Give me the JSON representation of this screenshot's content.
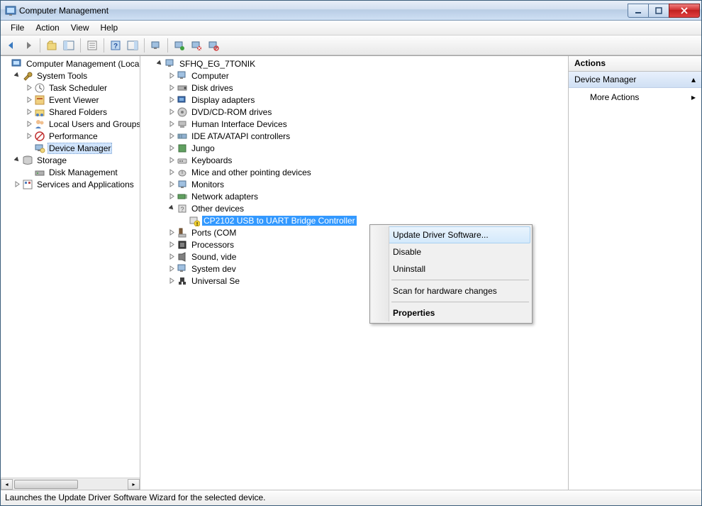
{
  "window": {
    "title": "Computer Management"
  },
  "menubar": [
    "File",
    "Action",
    "View",
    "Help"
  ],
  "left_tree": {
    "root": "Computer Management (Local",
    "system_tools": {
      "label": "System Tools",
      "children": [
        "Task Scheduler",
        "Event Viewer",
        "Shared Folders",
        "Local Users and Groups",
        "Performance",
        "Device Manager"
      ]
    },
    "storage": {
      "label": "Storage",
      "children": [
        "Disk Management"
      ]
    },
    "services": "Services and Applications"
  },
  "device_tree": {
    "root": "SFHQ_EG_7TONIK",
    "nodes": [
      "Computer",
      "Disk drives",
      "Display adapters",
      "DVD/CD-ROM drives",
      "Human Interface Devices",
      "IDE ATA/ATAPI controllers",
      "Jungo",
      "Keyboards",
      "Mice and other pointing devices",
      "Monitors",
      "Network adapters"
    ],
    "other_devices": {
      "label": "Other devices",
      "child": "CP2102 USB to UART Bridge Controller"
    },
    "after": [
      "Ports (COM",
      "Processors",
      "Sound, vide",
      "System dev",
      "Universal Se"
    ]
  },
  "context_menu": {
    "items": [
      "Update Driver Software...",
      "Disable",
      "Uninstall",
      "Scan for hardware changes",
      "Properties"
    ]
  },
  "actions": {
    "header": "Actions",
    "section": "Device Manager",
    "link": "More Actions"
  },
  "statusbar": "Launches the Update Driver Software Wizard for the selected device."
}
